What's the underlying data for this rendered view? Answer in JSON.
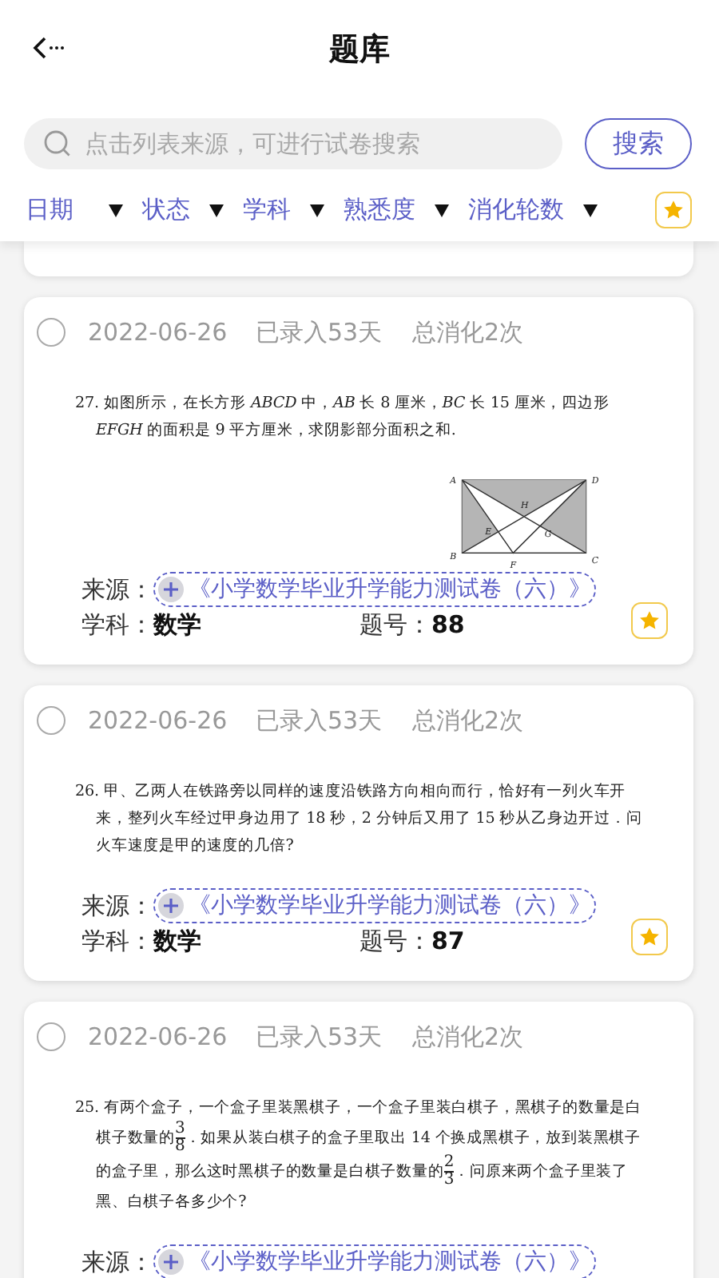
{
  "header": {
    "title": "题库"
  },
  "search": {
    "placeholder": "点击列表来源，可进行试卷搜索",
    "button": "搜索"
  },
  "filters": [
    {
      "label": "日期"
    },
    {
      "label": "状态"
    },
    {
      "label": "学科"
    },
    {
      "label": "熟悉度"
    },
    {
      "label": "消化轮数"
    }
  ],
  "questions": [
    {
      "selected": false,
      "date": "2022-06-26",
      "entered": "已录入53天",
      "digested": "总消化2次",
      "text": [
        {
          "kind": "text",
          "text": "27. 如图所示，在长方形 *ABCD* 中，*AB* 长 8 厘米，*BC* 长 15 厘米，四边形 *EFGH* 的面积是 9 平方厘米，求阴影部分面积之和."
        }
      ],
      "figure": {
        "labels": [
          "A",
          "D",
          "B",
          "C",
          "E",
          "F",
          "G",
          "H"
        ]
      },
      "source_label": "来源：",
      "source": "《小学数学毕业升学能力测试卷（六）》",
      "subject_label": "学科：",
      "subject": "数学",
      "number_label": "题号：",
      "number": "88"
    },
    {
      "selected": false,
      "date": "2022-06-26",
      "entered": "已录入53天",
      "digested": "总消化2次",
      "text": [
        {
          "kind": "text",
          "text": "26. 甲、乙两人在铁路旁以同样的速度沿铁路方向相向而行，恰好有一列火车开来，整列火车经过甲身边用了 18 秒，2 分钟后又用了 15 秒从乙身边开过．问火车速度是甲的速度的几倍?"
        }
      ],
      "source_label": "来源：",
      "source": "《小学数学毕业升学能力测试卷（六）》",
      "subject_label": "学科：",
      "subject": "数学",
      "number_label": "题号：",
      "number": "87"
    },
    {
      "selected": false,
      "date": "2022-06-26",
      "entered": "已录入53天",
      "digested": "总消化2次",
      "text": [
        {
          "kind": "text",
          "text": "25. 有两个盒子，一个盒子里装黑棋子，一个盒子里装白棋子，黑棋子的数量是白棋子数量的"
        },
        {
          "kind": "frac",
          "num": "3",
          "den": "8"
        },
        {
          "kind": "text",
          "text": "．如果从装白棋子的盒子里取出 14 个换成黑棋子，放到装黑棋子的盒子里，那么这时黑棋子的数量是白棋子数量的"
        },
        {
          "kind": "frac",
          "num": "2",
          "den": "3"
        },
        {
          "kind": "text",
          "text": "．问原来两个盒子里装了黑、白棋子各多少个?"
        }
      ],
      "source_label": "来源：",
      "source": "《小学数学毕业升学能力测试卷（六）》"
    }
  ]
}
